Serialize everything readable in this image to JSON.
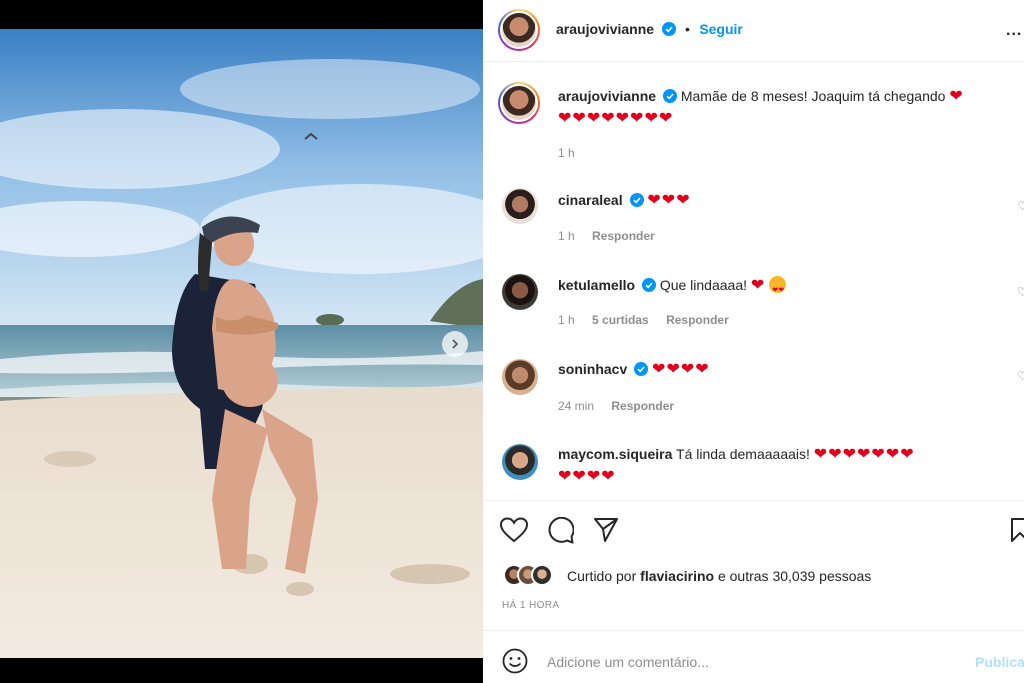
{
  "post": {
    "username": "araujovivianne",
    "follow_label": "Seguir",
    "more_label": "...",
    "caption_text": "Mamãe de 8 meses! Joaquim tá chegando",
    "caption_hearts_line1": "❤",
    "caption_hearts_line2": "❤❤❤❤❤❤❤❤",
    "caption_time": "1 h"
  },
  "comments": [
    {
      "username": "cinaraleal",
      "text": "",
      "hearts": "❤❤❤",
      "time": "1 h",
      "likes": "",
      "reply": "Responder"
    },
    {
      "username": "ketulamello",
      "text": "Que lindaaaa!",
      "hearts": "❤",
      "time": "1 h",
      "likes": "5 curtidas",
      "reply": "Responder"
    },
    {
      "username": "soninhacv",
      "text": "",
      "hearts": "❤❤❤❤",
      "time": "24 min",
      "likes": "",
      "reply": "Responder"
    },
    {
      "username": "maycom.siqueira",
      "text": "Tá linda demaaaaais!",
      "hearts": "❤❤❤❤❤❤❤",
      "hearts2": "❤❤❤❤",
      "time": "",
      "likes": "",
      "reply": ""
    }
  ],
  "engagement": {
    "liked_prefix": "Curtido por",
    "liked_user": "flaviacirino",
    "liked_suffix": "e outras 30,039 pessoas",
    "time_caps": "HÁ 1 HORA"
  },
  "composer": {
    "placeholder": "Adicione um comentário...",
    "publish_label": "Publica"
  },
  "icons": {
    "heart": "heart-icon",
    "comment": "comment-icon",
    "share": "share-icon",
    "save": "bookmark-icon",
    "emoji": "emoji-icon",
    "verified": "verified-badge-icon",
    "next": "chevron-right-icon"
  },
  "colors": {
    "accent": "#0095f6",
    "heart": "#e0001b",
    "muted": "#8e8e8e"
  }
}
